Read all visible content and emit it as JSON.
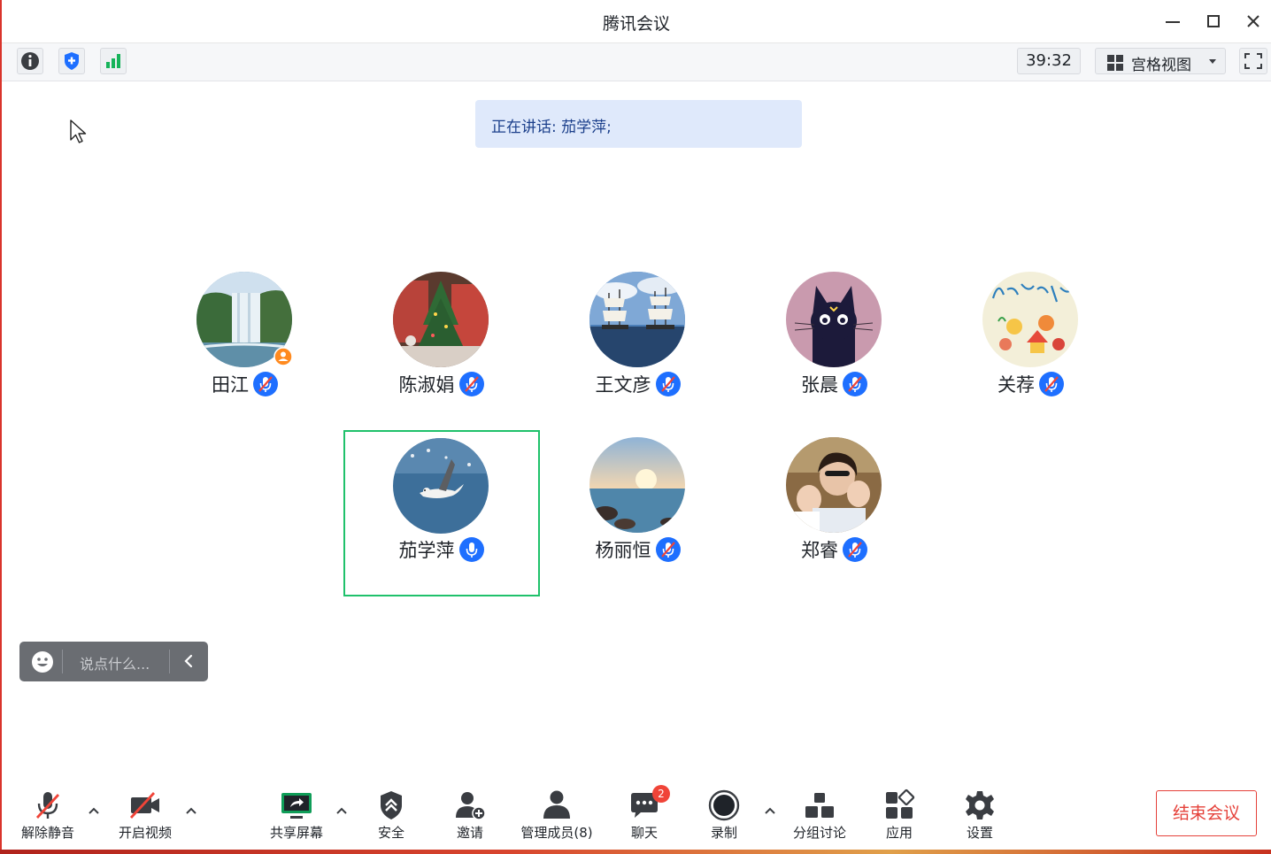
{
  "window": {
    "title": "腾讯会议"
  },
  "infobar": {
    "timer": "39:32",
    "view_label": "宫格视图"
  },
  "speaking": {
    "text": "正在讲话: 茄学萍;"
  },
  "participants": [
    {
      "name": "田江",
      "mic": "muted",
      "host": true
    },
    {
      "name": "陈淑娟",
      "mic": "muted",
      "host": false
    },
    {
      "name": "王文彦",
      "mic": "muted",
      "host": false
    },
    {
      "name": "张晨",
      "mic": "muted",
      "host": false
    },
    {
      "name": "关荐",
      "mic": "muted",
      "host": false
    },
    {
      "name": "茄学萍",
      "mic": "on",
      "host": false,
      "active": true
    },
    {
      "name": "杨丽恒",
      "mic": "muted",
      "host": false
    },
    {
      "name": "郑睿",
      "mic": "muted",
      "host": false
    }
  ],
  "chat_input": {
    "placeholder": "说点什么..."
  },
  "toolbar": {
    "unmute": "解除静音",
    "video": "开启视频",
    "share": "共享屏幕",
    "security": "安全",
    "invite": "邀请",
    "members": "管理成员(8)",
    "chat": "聊天",
    "chat_badge": "2",
    "record": "录制",
    "breakout": "分组讨论",
    "apps": "应用",
    "settings": "设置",
    "end": "结束会议"
  },
  "colors": {
    "accent_blue": "#1e6fff",
    "active_border": "#1fc16b",
    "end_red": "#e5413a"
  }
}
